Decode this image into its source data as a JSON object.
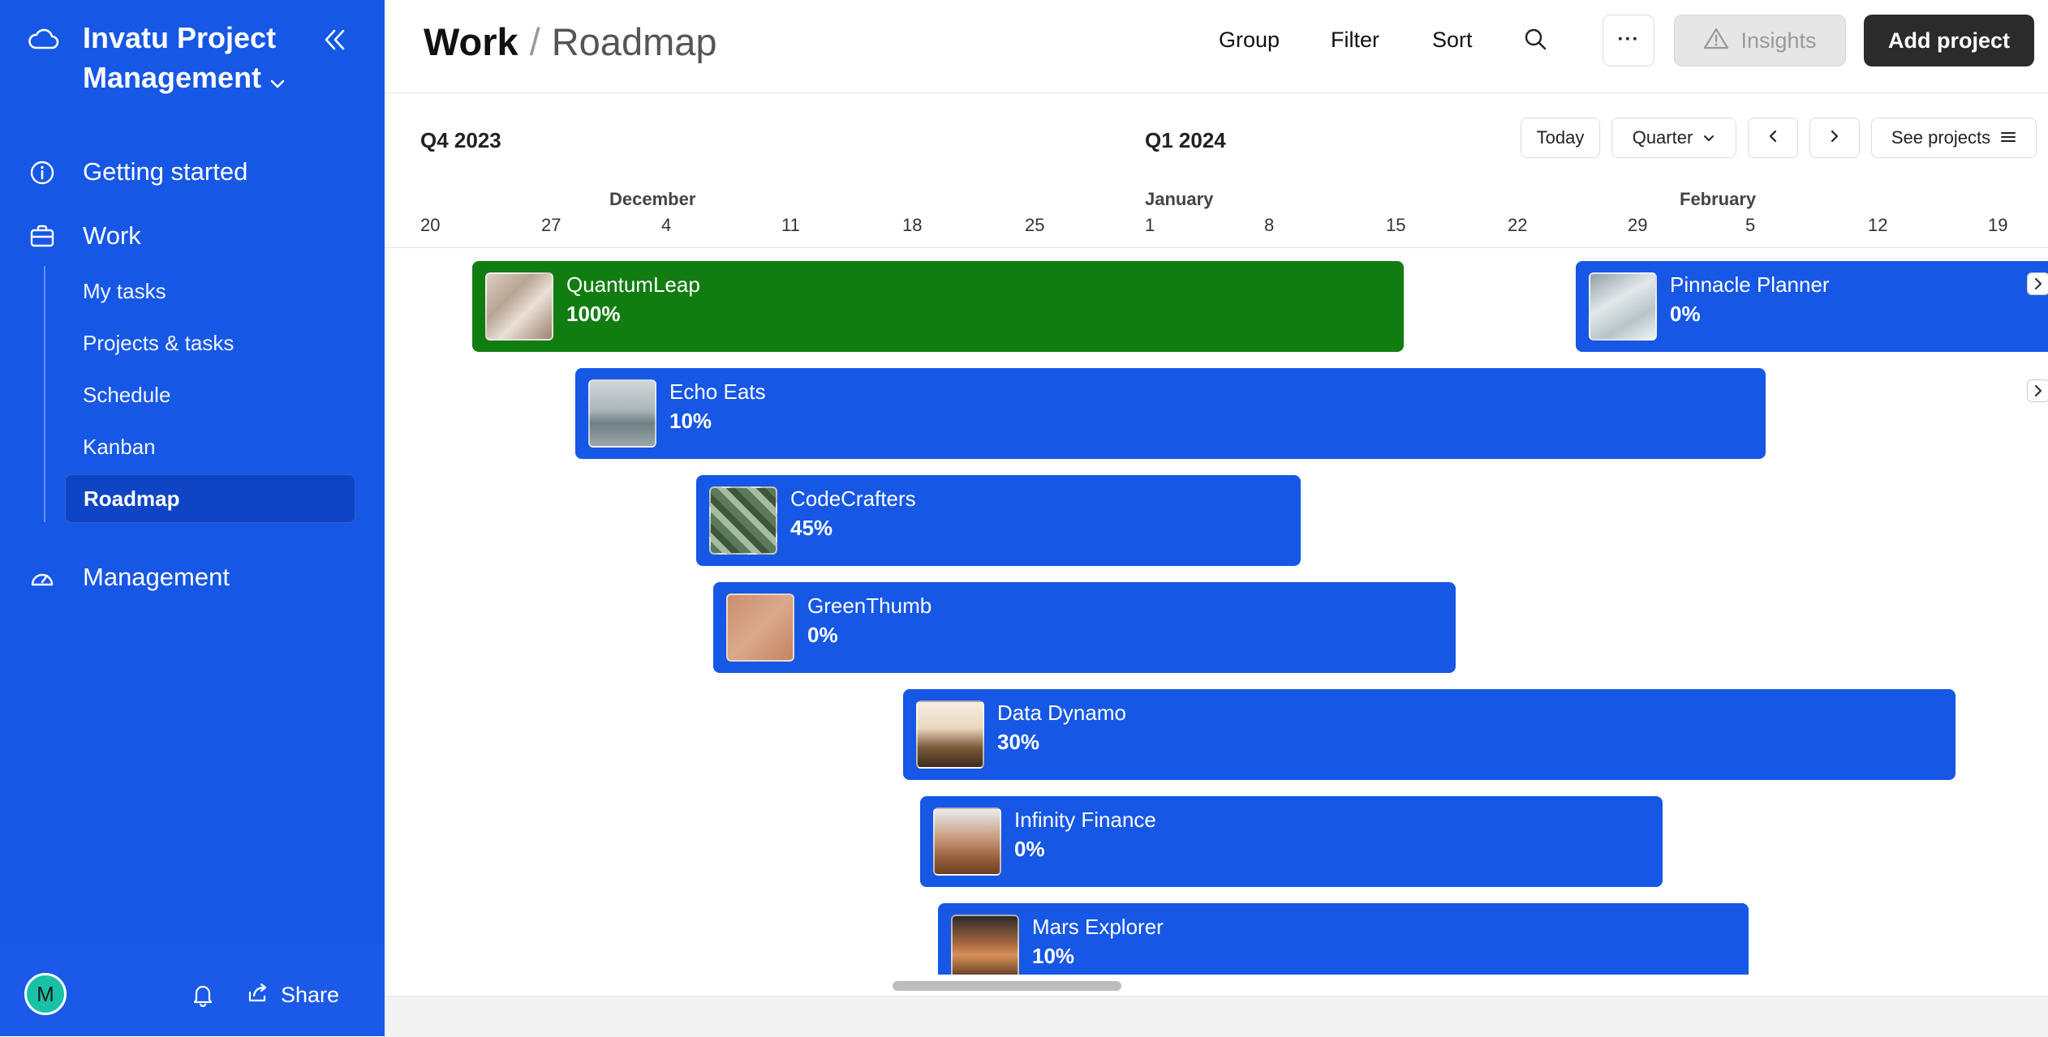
{
  "sidebar": {
    "title_line1": "Invatu Project",
    "title_line2": "Management",
    "nav": {
      "getting_started": "Getting started",
      "work": "Work",
      "management": "Management"
    },
    "work_items": [
      "My tasks",
      "Projects & tasks",
      "Schedule",
      "Kanban",
      "Roadmap"
    ],
    "active_item": "Roadmap",
    "footer": {
      "avatar_initial": "M",
      "share_label": "Share"
    }
  },
  "header": {
    "crumb_root": "Work",
    "crumb_separator": "/",
    "crumb_page": "Roadmap",
    "group_label": "Group",
    "filter_label": "Filter",
    "sort_label": "Sort",
    "more_label": "···",
    "insights_label": "Insights",
    "add_project_label": "Add project"
  },
  "timeline": {
    "quarters": [
      "Q4 2023",
      "Q1 2024"
    ],
    "controls": {
      "today_label": "Today",
      "scale_label": "Quarter",
      "see_projects_label": "See projects"
    },
    "months": [
      "December",
      "January",
      "February"
    ],
    "days": [
      "20",
      "27",
      "4",
      "11",
      "18",
      "25",
      "1",
      "8",
      "15",
      "22",
      "29",
      "5",
      "12",
      "19"
    ]
  },
  "projects": [
    {
      "name": "QuantumLeap",
      "progress": "100%",
      "status": "complete",
      "thumb": "grass-photo"
    },
    {
      "name": "Pinnacle Planner",
      "progress": "0%",
      "status": "in-progress",
      "thumb": "paper-photo"
    },
    {
      "name": "Echo Eats",
      "progress": "10%",
      "status": "in-progress",
      "thumb": "wave-photo"
    },
    {
      "name": "CodeCrafters",
      "progress": "45%",
      "status": "in-progress",
      "thumb": "maze-photo"
    },
    {
      "name": "GreenThumb",
      "progress": "0%",
      "status": "in-progress",
      "thumb": "sand-photo"
    },
    {
      "name": "Data Dynamo",
      "progress": "30%",
      "status": "in-progress",
      "thumb": "cliff-photo"
    },
    {
      "name": "Infinity Finance",
      "progress": "0%",
      "status": "in-progress",
      "thumb": "rock-photo"
    },
    {
      "name": "Mars Explorer",
      "progress": "10%",
      "status": "in-progress",
      "thumb": "canyon-photo"
    }
  ],
  "colors": {
    "sidebar": "#1657e5",
    "bar_active": "#1657e5",
    "bar_complete": "#117d11",
    "primary_button": "#2b2b2b"
  }
}
